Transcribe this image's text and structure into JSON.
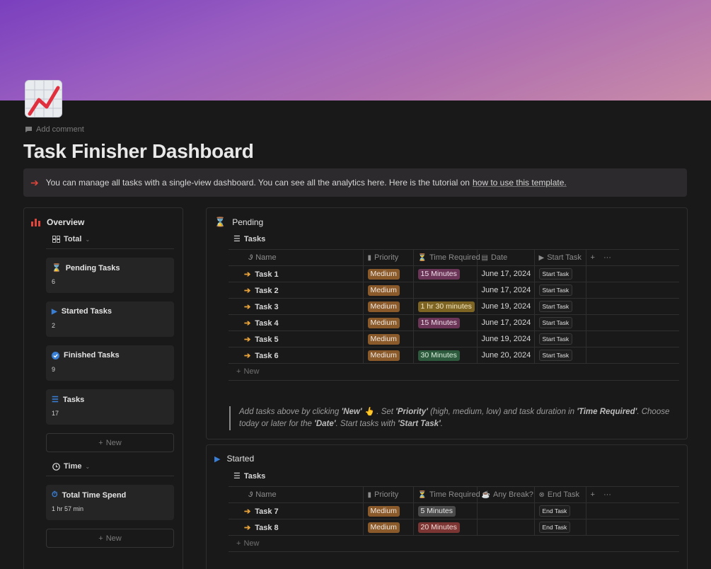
{
  "page": {
    "title": "Task Finisher Dashboard",
    "add_comment": "Add comment",
    "icon": "chart-increasing-icon"
  },
  "callout": {
    "icon": "right-arrow-icon",
    "text": "You can manage all tasks with a single-view dashboard. You can see all the analytics here. Here is the tutorial on",
    "link_text": "how to use this template."
  },
  "overview": {
    "title": "Overview",
    "total_view": "Total",
    "cards": [
      {
        "label": "Pending Tasks",
        "value": "6",
        "icon": "hourglass-icon"
      },
      {
        "label": "Started Tasks",
        "value": "2",
        "icon": "play-icon"
      },
      {
        "label": "Finished Tasks",
        "value": "9",
        "icon": "check-circle-icon"
      },
      {
        "label": "Tasks",
        "value": "17",
        "icon": "list-icon"
      }
    ],
    "new_label": "New",
    "time_view": "Time",
    "time_card": {
      "label": "Total Time Spend",
      "value": "1 hr 57 min",
      "icon": "stopwatch-icon"
    },
    "time_new_label": "New"
  },
  "pending": {
    "title": "Pending",
    "view": "Tasks",
    "columns": [
      "Name",
      "Priority",
      "Time Required",
      "Date",
      "Start Task"
    ],
    "rows": [
      {
        "name": "Task 1",
        "priority": "Medium",
        "time": "15 Minutes",
        "time_color": "pink",
        "date": "June 17, 2024",
        "action": "Start Task"
      },
      {
        "name": "Task 2",
        "priority": "Medium",
        "time": "",
        "time_color": "",
        "date": "June 17, 2024",
        "action": "Start Task"
      },
      {
        "name": "Task 3",
        "priority": "Medium",
        "time": "1 hr 30 minutes",
        "time_color": "gold",
        "date": "June 19, 2024",
        "action": "Start Task"
      },
      {
        "name": "Task 4",
        "priority": "Medium",
        "time": "15 Minutes",
        "time_color": "pink",
        "date": "June 17, 2024",
        "action": "Start Task"
      },
      {
        "name": "Task 5",
        "priority": "Medium",
        "time": "",
        "time_color": "",
        "date": "June 19, 2024",
        "action": "Start Task"
      },
      {
        "name": "Task 6",
        "priority": "Medium",
        "time": "30 Minutes",
        "time_color": "green",
        "date": "June 20, 2024",
        "action": "Start Task"
      }
    ],
    "new_label": "New"
  },
  "instructions": {
    "p1": "Add tasks above by clicking ",
    "new": "'New'",
    "p2": " 👆 . Set ",
    "priority": "'Priority'",
    "p3": " (high, medium, low) and task duration in ",
    "time_required": "'Time Required'",
    "p4": ". Choose today or later for the ",
    "date": "'Date'",
    "p5": ". Start tasks with ",
    "start_task": "'Start Task'",
    "p6": "."
  },
  "started": {
    "title": "Started",
    "view": "Tasks",
    "columns": [
      "Name",
      "Priority",
      "Time Required",
      "Any Break?",
      "End Task"
    ],
    "rows": [
      {
        "name": "Task 7",
        "priority": "Medium",
        "time": "5 Minutes",
        "time_color": "gray",
        "break": "",
        "action": "End Task"
      },
      {
        "name": "Task 8",
        "priority": "Medium",
        "time": "20 Minutes",
        "time_color": "red",
        "break": "",
        "action": "End Task"
      }
    ],
    "new_label": "New"
  },
  "colors": {
    "background": "#191919",
    "accent_orange": "#e8a23a",
    "callout_arrow": "#e0463b",
    "play_blue": "#3a7fd6",
    "medium_tag": "#8a5a2b"
  }
}
